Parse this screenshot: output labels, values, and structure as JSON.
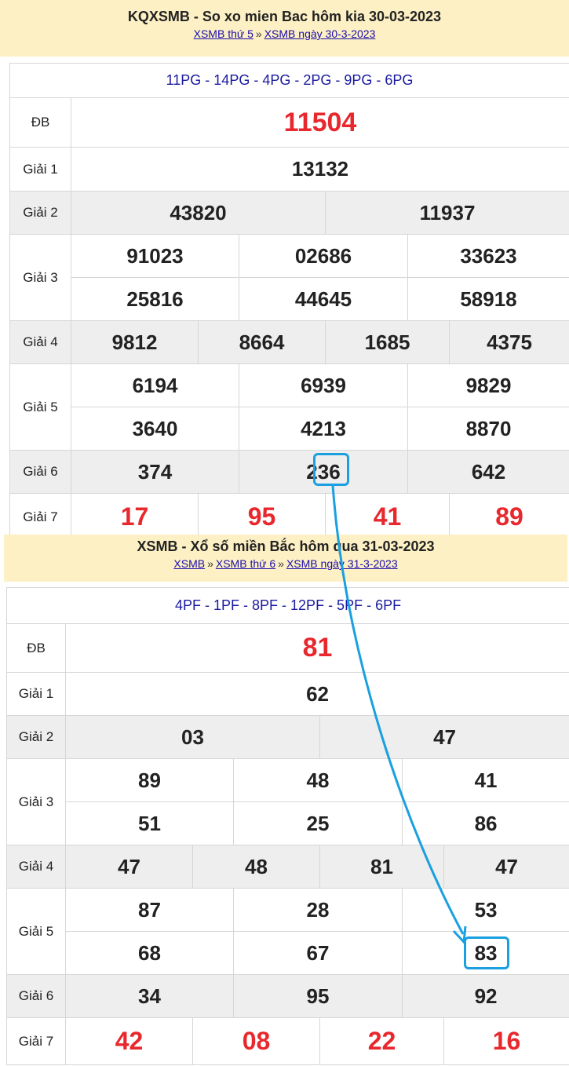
{
  "top": {
    "title": "KQXSMB - So xo mien Bac hôm kia 30-03-2023",
    "links": [
      "XSMB thứ 5",
      "XSMB ngày 30-3-2023"
    ],
    "codes": "11PG - 14PG - 4PG - 2PG - 9PG - 6PG",
    "labels": {
      "db": "ĐB",
      "g1": "Giải 1",
      "g2": "Giải 2",
      "g3": "Giải 3",
      "g4": "Giải 4",
      "g5": "Giải 5",
      "g6": "Giải 6",
      "g7": "Giải 7"
    },
    "db": "11504",
    "g1": "13132",
    "g2": [
      "43820",
      "11937"
    ],
    "g3": [
      "91023",
      "02686",
      "33623",
      "25816",
      "44645",
      "58918"
    ],
    "g4": [
      "9812",
      "8664",
      "1685",
      "4375"
    ],
    "g5": [
      "6194",
      "6939",
      "9829",
      "3640",
      "4213",
      "8870"
    ],
    "g6": [
      "374",
      "236",
      "642"
    ],
    "g7": [
      "17",
      "95",
      "41",
      "89"
    ]
  },
  "bottom": {
    "title": "XSMB - Xổ số miền Bắc hôm qua 31-03-2023",
    "links": [
      "XSMB",
      "XSMB thứ 6",
      "XSMB ngày 31-3-2023"
    ],
    "codes": "4PF - 1PF - 8PF - 12PF - 5PF - 6PF",
    "labels": {
      "db": "ĐB",
      "g1": "Giải 1",
      "g2": "Giải 2",
      "g3": "Giải 3",
      "g4": "Giải 4",
      "g5": "Giải 5",
      "g6": "Giải 6",
      "g7": "Giải 7"
    },
    "db": "81",
    "g1": "62",
    "g2": [
      "03",
      "47"
    ],
    "g3": [
      "89",
      "48",
      "41",
      "51",
      "25",
      "86"
    ],
    "g4": [
      "47",
      "48",
      "81",
      "47"
    ],
    "g5": [
      "87",
      "28",
      "53",
      "68",
      "67",
      "83"
    ],
    "g6": [
      "34",
      "95",
      "92"
    ],
    "g7": [
      "42",
      "08",
      "22",
      "16"
    ]
  },
  "colors": {
    "highlight": "#1aa0e0",
    "red": "#e8282d",
    "header_bg": "#fdf0c4",
    "codes_blue": "#1a1aa0"
  }
}
